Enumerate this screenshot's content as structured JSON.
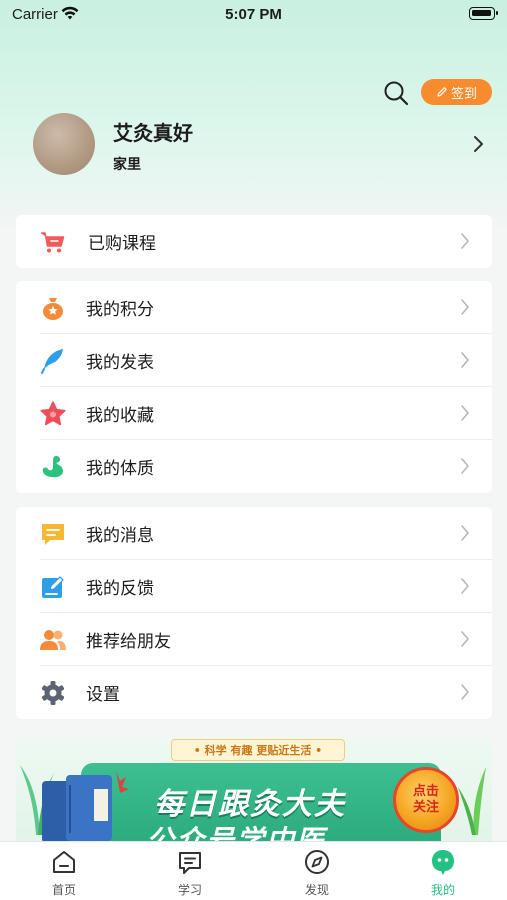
{
  "status_bar": {
    "carrier": "Carrier",
    "time": "5:07 PM"
  },
  "header": {
    "signin_label": "签到"
  },
  "profile": {
    "name": "艾灸真好",
    "subtitle": "家里"
  },
  "purchased": {
    "label": "已购课程"
  },
  "group1": [
    {
      "label": "我的积分",
      "icon": "points-bag-icon"
    },
    {
      "label": "我的发表",
      "icon": "feather-icon"
    },
    {
      "label": "我的收藏",
      "icon": "star-icon"
    },
    {
      "label": "我的体质",
      "icon": "muscle-icon"
    }
  ],
  "group2": [
    {
      "label": "我的消息",
      "icon": "message-icon"
    },
    {
      "label": "我的反馈",
      "icon": "feedback-icon"
    },
    {
      "label": "推荐给朋友",
      "icon": "friends-icon"
    },
    {
      "label": "设置",
      "icon": "gear-icon"
    }
  ],
  "banner": {
    "tag": "• 科学 有趣 更贴近生活 •",
    "line1": "每日跟灸大夫",
    "line2": "公众号学中医",
    "follow_line1": "点击",
    "follow_line2": "关注"
  },
  "tabbar": {
    "home": "首页",
    "study": "学习",
    "discover": "发现",
    "mine": "我的"
  },
  "colors": {
    "accent_green": "#23c283",
    "signin_orange": "#f78b2d"
  }
}
